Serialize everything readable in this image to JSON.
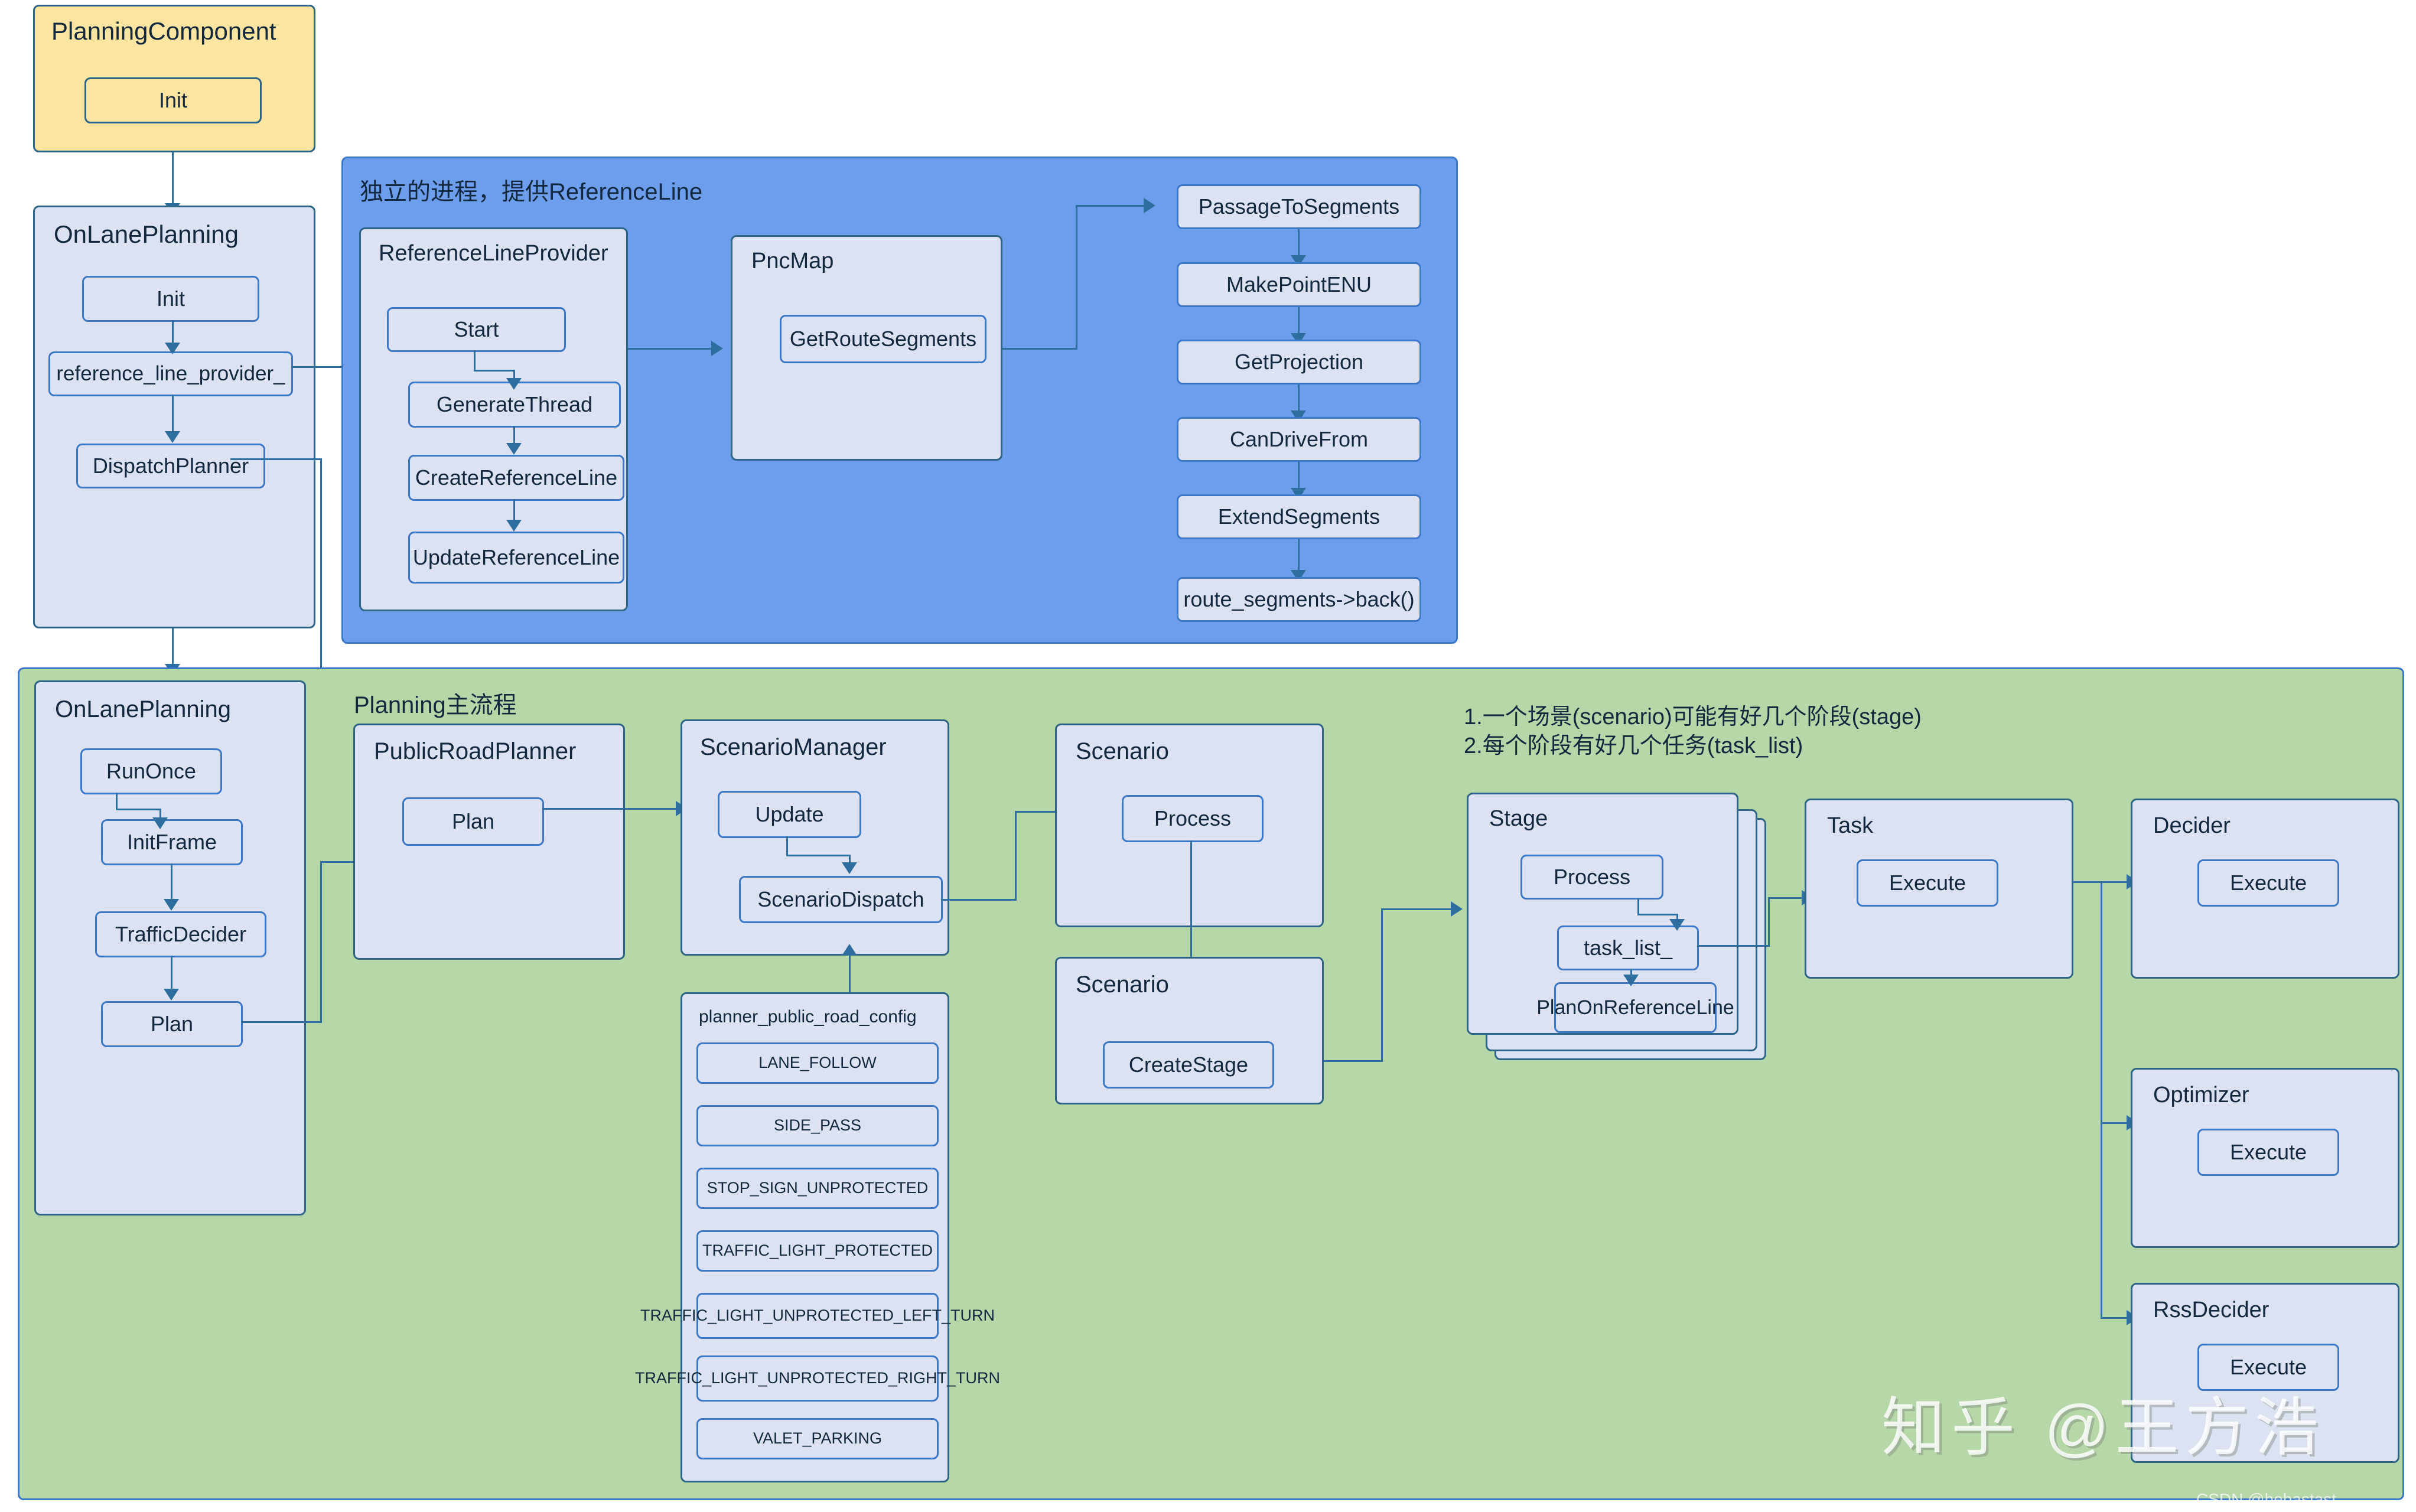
{
  "colors": {
    "yellow_group": "#FCE5A0",
    "blue_group": "#6D9EEB",
    "green_group": "#B6D7A8",
    "node_fill": "#DCE2F1",
    "node_border": "#3C78C8",
    "dark_border": "#2E6485",
    "text": "#12283E",
    "connector": "#2E6E9E"
  },
  "planning_component": {
    "title": "PlanningComponent",
    "init": "Init"
  },
  "on_lane_planning_top": {
    "title": "OnLanePlanning",
    "init": "Init",
    "reference_line_provider": "reference_line_provider_",
    "dispatch_planner": "DispatchPlanner"
  },
  "reference_line_section": {
    "caption": "独立的进程，提供ReferenceLine",
    "provider": {
      "title": "ReferenceLineProvider",
      "start": "Start",
      "generate_thread": "GenerateThread",
      "create_reference_line": "CreateReferenceLine",
      "update_reference_line": "UpdateReferenceLine"
    },
    "pnc_map": {
      "title": "PncMap",
      "get_route_segments": "GetRouteSegments"
    },
    "route_steps": [
      "PassageToSegments",
      "MakePointENU",
      "GetProjection",
      "CanDriveFrom",
      "ExtendSegments",
      "route_segments->back()"
    ]
  },
  "planning_main": {
    "caption": "Planning主流程",
    "on_lane_planning": {
      "title": "OnLanePlanning",
      "steps": [
        "RunOnce",
        "InitFrame",
        "TrafficDecider",
        "Plan"
      ]
    },
    "public_road_planner": {
      "title": "PublicRoadPlanner",
      "plan": "Plan"
    },
    "scenario_manager": {
      "title": "ScenarioManager",
      "update": "Update",
      "scenario_dispatch": "ScenarioDispatch"
    },
    "planner_public_road_config": {
      "title": "planner_public_road_config",
      "items": [
        "LANE_FOLLOW",
        "SIDE_PASS",
        "STOP_SIGN_UNPROTECTED",
        "TRAFFIC_LIGHT_PROTECTED",
        "TRAFFIC_LIGHT_UNPROTECTED_LEFT_TURN",
        "TRAFFIC_LIGHT_UNPROTECTED_RIGHT_TURN",
        "VALET_PARKING"
      ]
    },
    "scenario_process": {
      "title": "Scenario",
      "process": "Process"
    },
    "scenario_create_stage": {
      "title": "Scenario",
      "create_stage": "CreateStage"
    },
    "notes": "1.一个场景(scenario)可能有好几个阶段(stage)\n2.每个阶段有好几个任务(task_list)",
    "stage": {
      "title": "Stage",
      "process": "Process",
      "task_list": "task_list_",
      "plan_on_reference_line": "PlanOnReferenceLine"
    },
    "task": {
      "title": "Task",
      "execute": "Execute"
    },
    "decider": {
      "title": "Decider",
      "execute": "Execute"
    },
    "optimizer": {
      "title": "Optimizer",
      "execute": "Execute"
    },
    "rss_decider": {
      "title": "RssDecider",
      "execute": "Execute"
    }
  },
  "watermarks": {
    "zhihu": "知乎 @王方浩",
    "csdn": "CSDN @hebastast"
  }
}
